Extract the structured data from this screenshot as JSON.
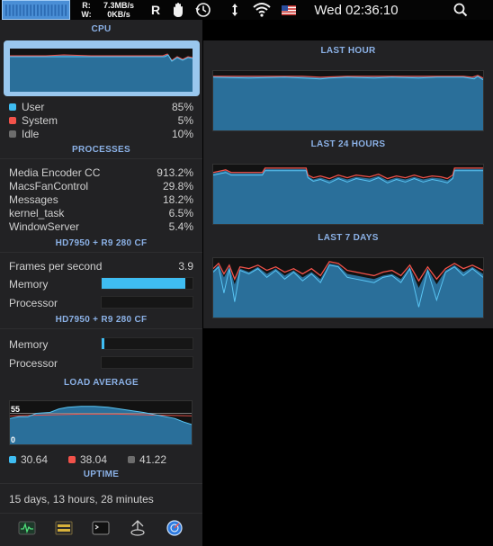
{
  "menubar": {
    "net_labels": [
      "R:",
      "W:"
    ],
    "net_values": [
      "7.3MB/s",
      "0KB/s"
    ],
    "r_label": "R",
    "clock": "Wed 02:36:10"
  },
  "cpu": {
    "title": "CPU",
    "user_label": "User",
    "user_value": "85%",
    "system_label": "System",
    "system_value": "5%",
    "idle_label": "Idle",
    "idle_value": "10%"
  },
  "processes": {
    "title": "PROCESSES",
    "items": [
      {
        "name": "Media Encoder CC",
        "value": "913.2%"
      },
      {
        "name": "MacsFanControl",
        "value": "29.8%"
      },
      {
        "name": "Messages",
        "value": "18.2%"
      },
      {
        "name": "kernel_task",
        "value": "6.5%"
      },
      {
        "name": "WindowServer",
        "value": "5.4%"
      }
    ]
  },
  "gpu1": {
    "title": "HD7950 + R9 280 CF",
    "fps_label": "Frames per second",
    "fps_value": "3.9",
    "memory_label": "Memory",
    "memory_level": 0.92,
    "processor_label": "Processor",
    "processor_level": 0.0
  },
  "gpu2": {
    "title": "HD7950 + R9 280 CF",
    "memory_label": "Memory",
    "memory_level": 0.03,
    "processor_label": "Processor",
    "processor_level": 0.0
  },
  "load": {
    "title": "LOAD AVERAGE",
    "max_label": "55",
    "min_label": "0",
    "values": [
      "30.64",
      "38.04",
      "41.22"
    ]
  },
  "uptime": {
    "title": "UPTIME",
    "value": "15 days, 13 hours, 28 minutes"
  },
  "history": {
    "last_hour": "LAST HOUR",
    "last_24": "LAST 24 HOURS",
    "last_7": "LAST 7 DAYS"
  },
  "colors": {
    "user": "#3fbdf2",
    "system": "#f2524a",
    "idle": "#6d6d6d",
    "title": "#8bb1e6",
    "fill": "#2a6f9a"
  },
  "icons": [
    "cpu-mini-graph-icon",
    "hand-icon",
    "time-machine-icon",
    "arrows-icon",
    "wifi-icon",
    "us-flag-icon",
    "search-icon",
    "activity-monitor-icon",
    "fan-control-icon",
    "terminal-icon",
    "network-icon",
    "disk-utility-icon"
  ]
}
